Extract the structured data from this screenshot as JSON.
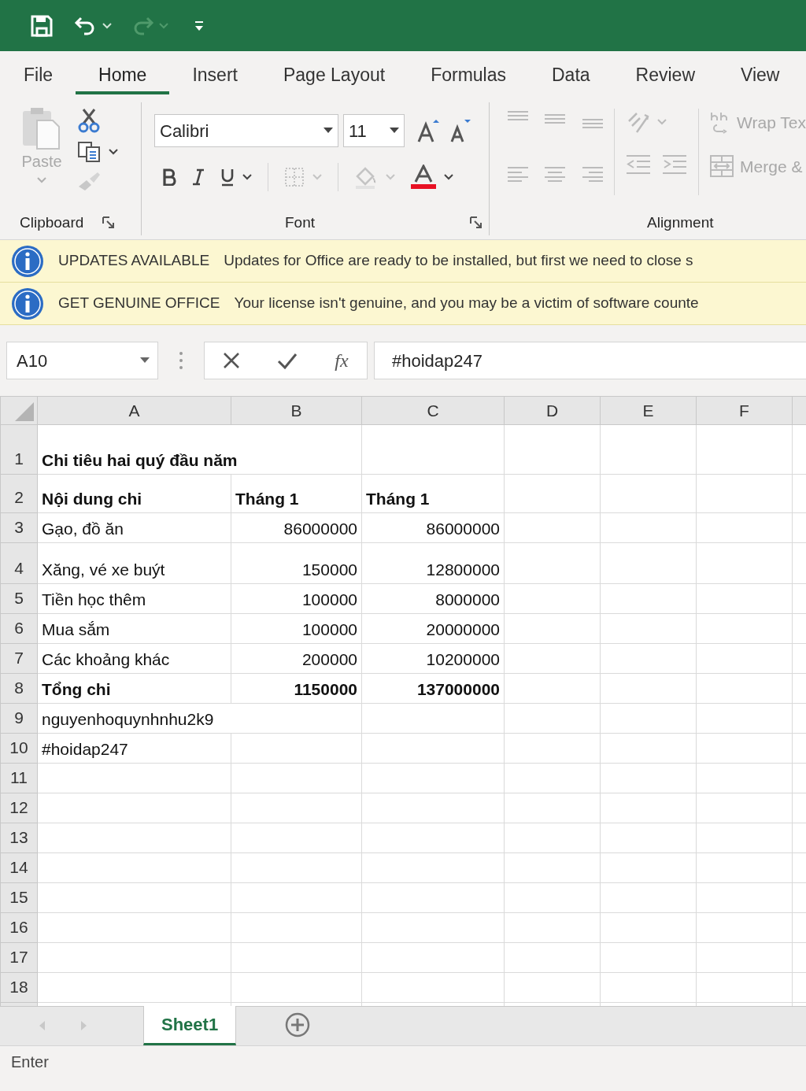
{
  "ribbon_tabs": [
    {
      "label": "File",
      "selected": false
    },
    {
      "label": "Home",
      "selected": true
    },
    {
      "label": "Insert",
      "selected": false
    },
    {
      "label": "Page Layout",
      "selected": false
    },
    {
      "label": "Formulas",
      "selected": false
    },
    {
      "label": "Data",
      "selected": false
    },
    {
      "label": "Review",
      "selected": false
    },
    {
      "label": "View",
      "selected": false
    }
  ],
  "ribbon": {
    "paste": {
      "label": "Paste",
      "disabled": true
    },
    "font_name": "Calibri",
    "font_size": "11",
    "wrap_text": {
      "label": "Wrap Tex",
      "disabled": true
    },
    "merge": {
      "label": "Merge &",
      "disabled": true
    },
    "groups": [
      "Clipboard",
      "Font",
      "Alignment"
    ]
  },
  "message_bars": [
    {
      "title": "UPDATES AVAILABLE",
      "text": "Updates for Office are ready to be installed, but first we need to close s"
    },
    {
      "title": "GET GENUINE OFFICE",
      "text": "Your license isn't genuine, and you may be a victim of software counte"
    }
  ],
  "formula_bar": {
    "name_box": "A10",
    "function_label": "fx",
    "formula": "#hoidap247"
  },
  "sheet": {
    "columns": [
      "A",
      "B",
      "C",
      "D",
      "E",
      "F"
    ],
    "rows": [
      {
        "number": "1",
        "bold": true,
        "cells": [
          {
            "text": "Chi tiêu hai quý đầu năm",
            "kind": "text",
            "colspan": 2
          }
        ]
      },
      {
        "number": "2",
        "bold": true,
        "cells": [
          {
            "text": "Nội dung chi",
            "kind": "text"
          },
          {
            "text": "Tháng 1",
            "kind": "text"
          },
          {
            "text": "Tháng 1",
            "kind": "text"
          }
        ]
      },
      {
        "number": "3",
        "bold": false,
        "cells": [
          {
            "text": "Gạo, đồ ăn",
            "kind": "text"
          },
          {
            "text": "86000000",
            "kind": "number"
          },
          {
            "text": "86000000",
            "kind": "number"
          }
        ]
      },
      {
        "number": "4",
        "bold": false,
        "cells": [
          {
            "text": "Xăng, vé xe buýt",
            "kind": "text"
          },
          {
            "text": "150000",
            "kind": "number"
          },
          {
            "text": "12800000",
            "kind": "number"
          }
        ]
      },
      {
        "number": "5",
        "bold": false,
        "cells": [
          {
            "text": "Tiền học thêm",
            "kind": "text"
          },
          {
            "text": "100000",
            "kind": "number"
          },
          {
            "text": "8000000",
            "kind": "number"
          }
        ]
      },
      {
        "number": "6",
        "bold": false,
        "cells": [
          {
            "text": "Mua sắm",
            "kind": "text"
          },
          {
            "text": "100000",
            "kind": "number"
          },
          {
            "text": "20000000",
            "kind": "number"
          }
        ]
      },
      {
        "number": "7",
        "bold": false,
        "cells": [
          {
            "text": "Các khoảng khác",
            "kind": "text"
          },
          {
            "text": "200000",
            "kind": "number"
          },
          {
            "text": "10200000",
            "kind": "number"
          }
        ]
      },
      {
        "number": "8",
        "bold": true,
        "cells": [
          {
            "text": "Tổng chi",
            "kind": "text"
          },
          {
            "text": "1150000",
            "kind": "number"
          },
          {
            "text": "137000000",
            "kind": "number"
          }
        ]
      },
      {
        "number": "9",
        "bold": false,
        "cells": [
          {
            "text": "nguyenhoquynhnhu2k9",
            "kind": "text",
            "colspan": 2
          }
        ]
      },
      {
        "number": "10",
        "bold": false,
        "cells": [
          {
            "text": "#hoidap247",
            "kind": "text"
          }
        ]
      },
      {
        "number": "11"
      },
      {
        "number": "12"
      },
      {
        "number": "13"
      },
      {
        "number": "14"
      },
      {
        "number": "15"
      },
      {
        "number": "16"
      },
      {
        "number": "17"
      },
      {
        "number": "18"
      }
    ]
  },
  "sheet_tabs": [
    {
      "label": "Sheet1",
      "selected": true
    }
  ],
  "status_bar": {
    "mode": "Enter"
  }
}
